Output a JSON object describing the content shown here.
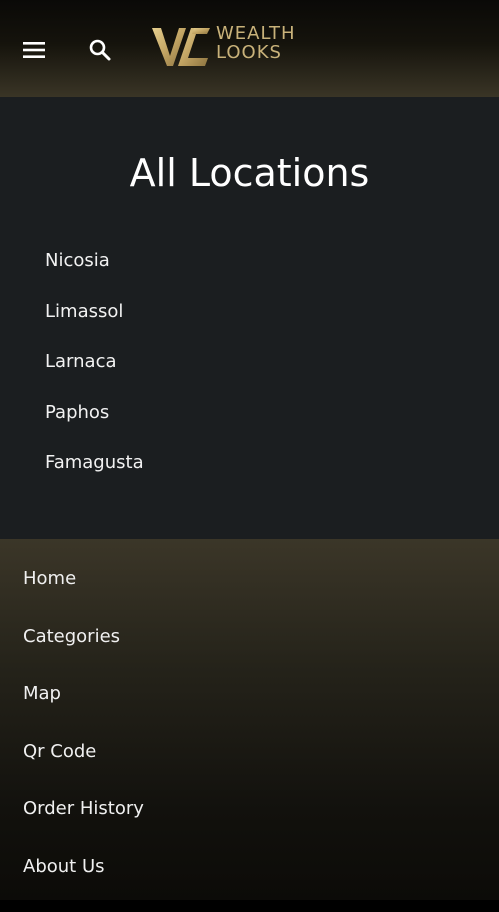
{
  "header": {
    "menu_icon": "hamburger-menu-icon",
    "search_icon": "search-icon",
    "logo": {
      "line1": "WEALTH",
      "line2": "LOOKS",
      "color": "#c9b27a"
    }
  },
  "locations": {
    "title": "All Locations",
    "items": [
      {
        "label": "Nicosia"
      },
      {
        "label": "Limassol"
      },
      {
        "label": "Larnaca"
      },
      {
        "label": "Paphos"
      },
      {
        "label": "Famagusta"
      }
    ]
  },
  "nav": {
    "items": [
      {
        "label": "Home"
      },
      {
        "label": "Categories"
      },
      {
        "label": "Map"
      },
      {
        "label": "Qr Code"
      },
      {
        "label": "Order History"
      },
      {
        "label": "About Us"
      }
    ]
  }
}
